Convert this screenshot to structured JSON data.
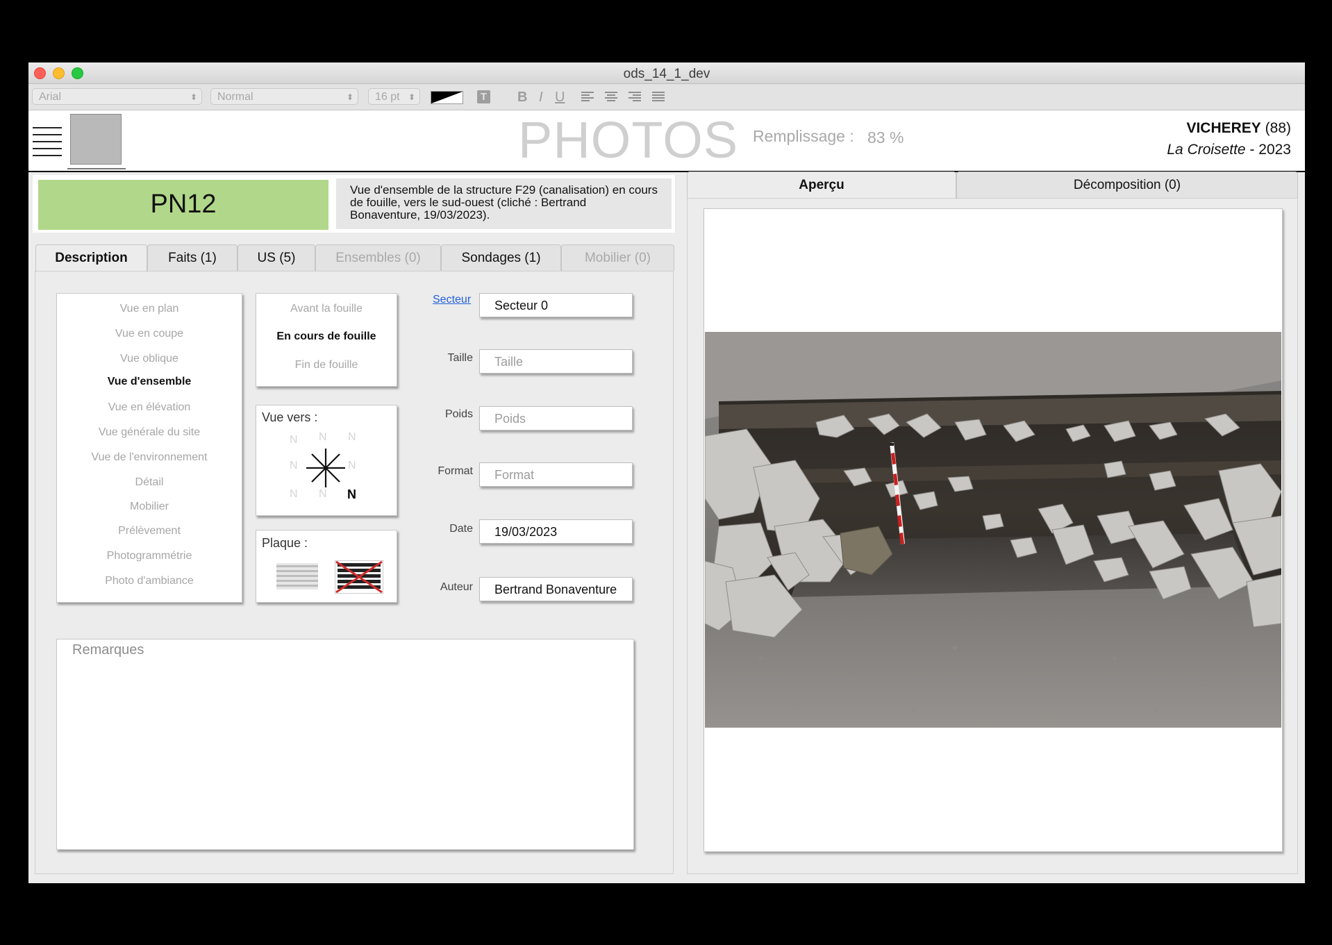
{
  "window": {
    "title": "ods_14_1_dev"
  },
  "toolbar": {
    "font": "Arial",
    "style": "Normal",
    "size": "16 pt",
    "bold": "B",
    "italic": "I",
    "underline": "U"
  },
  "header": {
    "title": "PHOTOS",
    "fill_label": "Remplissage :",
    "fill_value": "83 %",
    "site_name": "VICHEREY",
    "site_dept": " (88)",
    "site_locality": "La Croisette",
    "site_year": " - 2023"
  },
  "record": {
    "id": "PN12",
    "description": "Vue d'ensemble de la structure F29 (canalisation) en cours de fouille, vers le sud-ouest (cliché : Bertrand Bonaventure, 19/03/2023)."
  },
  "tabs_left": [
    {
      "label": "Description"
    },
    {
      "label": "Faits (1)"
    },
    {
      "label": "US (5)"
    },
    {
      "label": "Ensembles (0)"
    },
    {
      "label": "Sondages (1)"
    },
    {
      "label": "Mobilier (0)"
    }
  ],
  "view_types": [
    "Vue en plan",
    "Vue en coupe",
    "Vue oblique",
    "Vue d'ensemble",
    "Vue en élévation",
    "Vue générale du site",
    "Vue de l'environnement",
    "Détail",
    "Mobilier",
    "Prélèvement",
    "Photogrammétrie",
    "Photo d'ambiance"
  ],
  "selected_view_type": "Vue d'ensemble",
  "phases": [
    "Avant la fouille",
    "En cours de fouille",
    "Fin de fouille"
  ],
  "selected_phase": "En cours de fouille",
  "orientation": {
    "label": "Vue vers :",
    "letter": "N"
  },
  "plaque": {
    "label": "Plaque :"
  },
  "fields": {
    "secteur_label": "Secteur",
    "secteur_value": "Secteur 0",
    "taille_label": "Taille",
    "taille_placeholder": "Taille",
    "poids_label": "Poids",
    "poids_placeholder": "Poids",
    "format_label": "Format",
    "format_placeholder": "Format",
    "date_label": "Date",
    "date_value": "19/03/2023",
    "auteur_label": "Auteur",
    "auteur_value": "Bertrand Bonaventure"
  },
  "remarks": {
    "placeholder": "Remarques"
  },
  "tabs_right": [
    {
      "label": "Aperçu"
    },
    {
      "label": "Décomposition (0)"
    }
  ],
  "colors": {
    "id_badge": "#b1d88a",
    "close": "#fe5f57",
    "minimize": "#febc2e",
    "zoom": "#28c840",
    "link": "#1f5fd6",
    "plaque_cross": "#d22b2b"
  }
}
